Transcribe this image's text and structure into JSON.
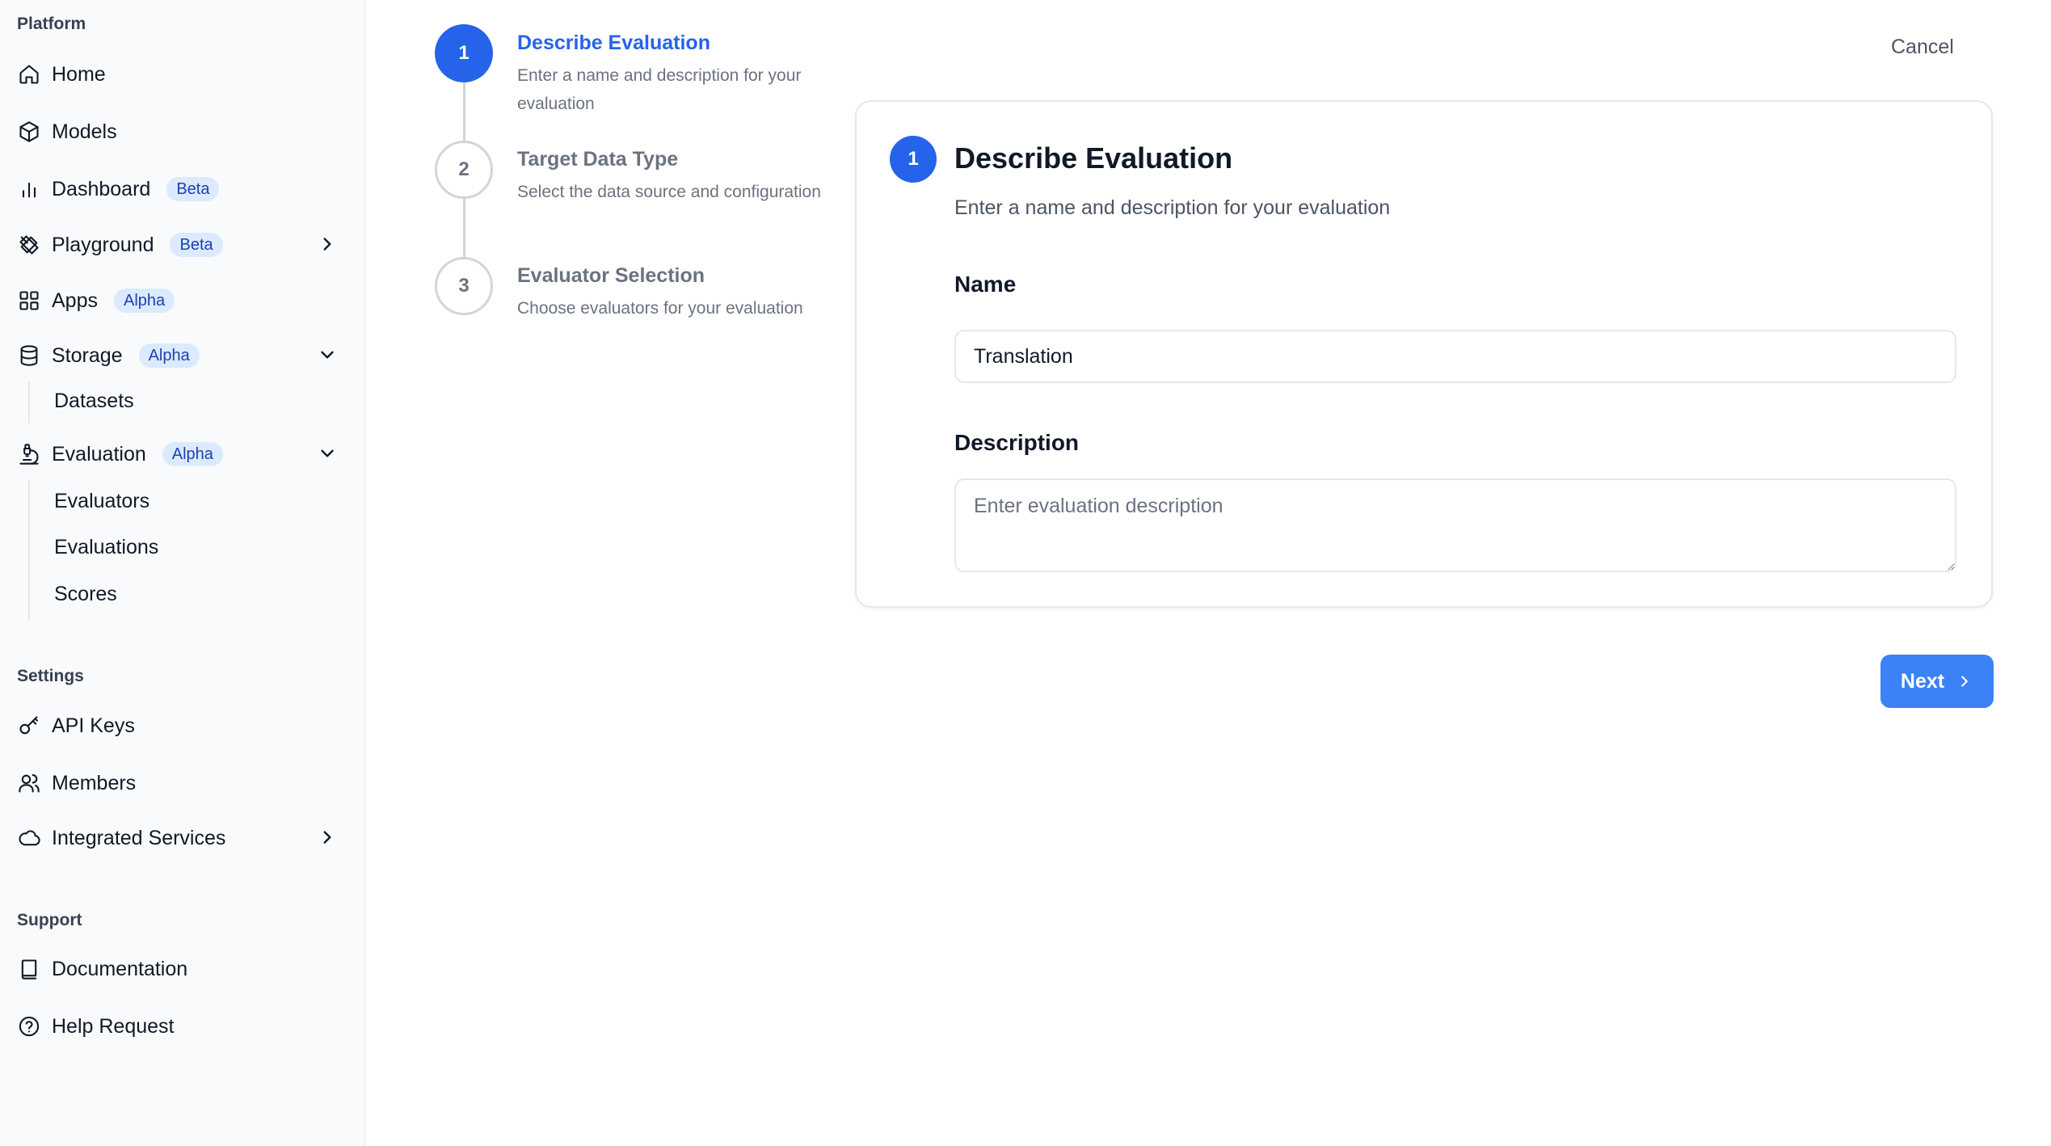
{
  "sidebar": {
    "platform_title": "Platform",
    "settings_title": "Settings",
    "support_title": "Support",
    "items": {
      "home": {
        "label": "Home",
        "icon": "home-icon"
      },
      "models": {
        "label": "Models",
        "icon": "cube-icon"
      },
      "dashboard": {
        "label": "Dashboard",
        "badge": "Beta",
        "icon": "bar-chart-icon"
      },
      "playground": {
        "label": "Playground",
        "badge": "Beta",
        "icon": "tools-icon"
      },
      "apps": {
        "label": "Apps",
        "badge": "Alpha",
        "icon": "grid-icon"
      },
      "storage": {
        "label": "Storage",
        "badge": "Alpha",
        "icon": "database-icon"
      },
      "evaluation": {
        "label": "Evaluation",
        "badge": "Alpha",
        "icon": "microscope-icon"
      },
      "api_keys": {
        "label": "API Keys",
        "icon": "key-icon"
      },
      "members": {
        "label": "Members",
        "icon": "users-icon"
      },
      "integrated_services": {
        "label": "Integrated Services",
        "icon": "cloud-icon"
      },
      "documentation": {
        "label": "Documentation",
        "icon": "book-icon"
      },
      "help_request": {
        "label": "Help Request",
        "icon": "help-circle-icon"
      }
    },
    "storage_sub": [
      "Datasets"
    ],
    "evaluation_sub": [
      "Evaluators",
      "Evaluations",
      "Scores"
    ]
  },
  "stepper": {
    "steps": [
      {
        "number": "1",
        "title": "Describe Evaluation",
        "description": "Enter a name and description for your evaluation"
      },
      {
        "number": "2",
        "title": "Target Data Type",
        "description": "Select the data source and configuration"
      },
      {
        "number": "3",
        "title": "Evaluator Selection",
        "description": "Choose evaluators for your evaluation"
      }
    ]
  },
  "header": {
    "cancel_label": "Cancel"
  },
  "card": {
    "number": "1",
    "title": "Describe Evaluation",
    "subtitle": "Enter a name and description for your evaluation",
    "name_label": "Name",
    "name_value": "Translation",
    "description_label": "Description",
    "description_placeholder": "Enter evaluation description"
  },
  "footer": {
    "next_label": "Next"
  },
  "colors": {
    "accent": "#2563eb",
    "button": "#3b82f6",
    "badge_bg": "#dbeafe",
    "badge_text": "#1e40af"
  }
}
